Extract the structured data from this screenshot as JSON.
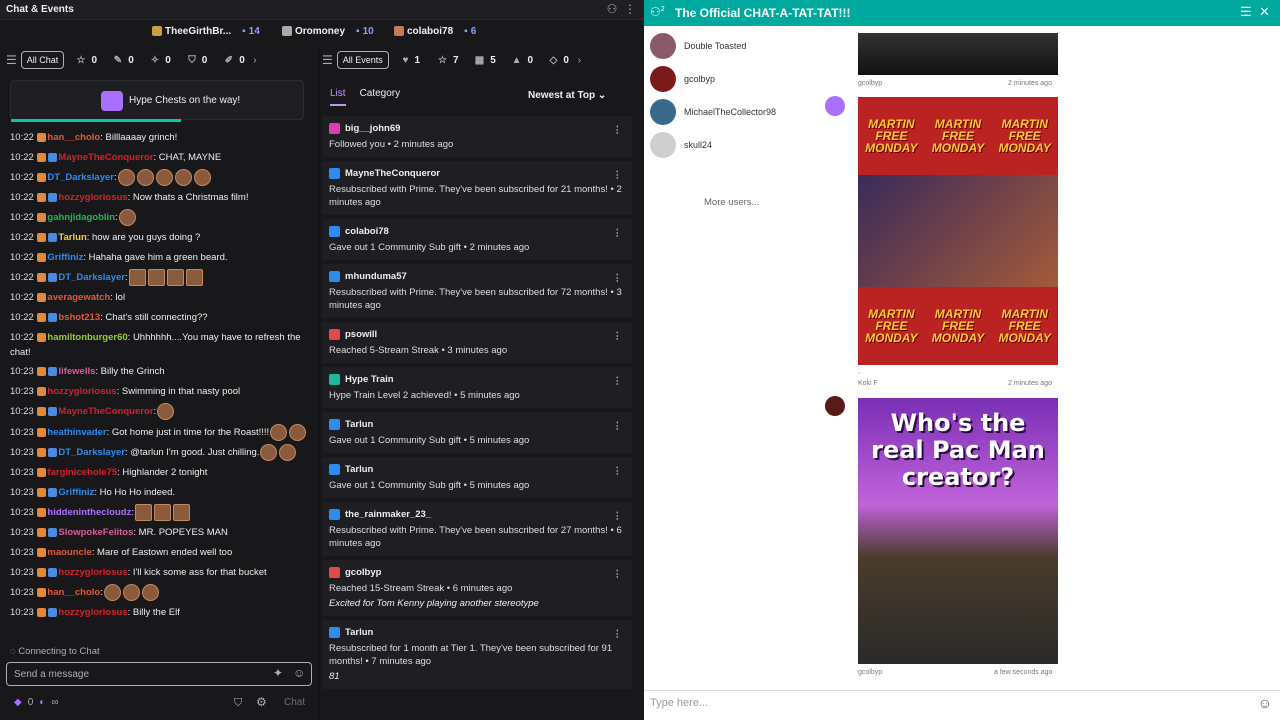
{
  "left": {
    "title": "Chat & Events",
    "top_chatters": [
      {
        "name": "TheeGirthBr...",
        "count": "14",
        "color": "#c9a23f"
      },
      {
        "name": "Oromoney",
        "count": "10",
        "color": "#aaa"
      },
      {
        "name": "colaboi78",
        "count": "6",
        "color": "#c7795a"
      }
    ],
    "chat_bar": {
      "filter": "All Chat",
      "counts": [
        "0",
        "0",
        "0",
        "0",
        "0"
      ]
    },
    "events_bar": {
      "filter": "All Events",
      "counts": [
        "1",
        "7",
        "5",
        "0",
        "0"
      ]
    },
    "hype": "Hype Chests on the way!",
    "messages": [
      {
        "time": "10:22",
        "user": "han__cholo",
        "color": "#e05a3a",
        "text": ": Billlaaaay grinch!",
        "emotes": 0
      },
      {
        "time": "10:22",
        "user": "MayneTheConqueror",
        "color": "#d0232d",
        "text": ": CHAT, MAYNE",
        "emotes": 0
      },
      {
        "time": "10:22",
        "user": "DT_Darkslayer",
        "color": "#2d8cf0",
        "text": ":",
        "emotes": 5
      },
      {
        "time": "10:22",
        "user": "hozzygloriosus",
        "color": "#d0232d",
        "text": ": Now thats a Christmas film!",
        "emotes": 0
      },
      {
        "time": "10:22",
        "user": "gahnjidagoblin",
        "color": "#1fb859",
        "text": ":",
        "emotes": 1
      },
      {
        "time": "10:22",
        "user": "Tarlun",
        "color": "#e8d34a",
        "text": ": how are you guys doing ?",
        "emotes": 0
      },
      {
        "time": "10:22",
        "user": "Griffiniz",
        "color": "#2d8cf0",
        "text": ": Hahaha gave him a green beard.",
        "emotes": 0
      },
      {
        "time": "10:22",
        "user": "DT_Darkslayer",
        "color": "#2d8cf0",
        "text": ":",
        "emotes": 4
      },
      {
        "time": "10:22",
        "user": "averagewatch",
        "color": "#e05a3a",
        "text": ": lol",
        "emotes": 0
      },
      {
        "time": "10:22",
        "user": "bshot213",
        "color": "#e05a3a",
        "text": ": Chat's still connecting??",
        "emotes": 0
      },
      {
        "time": "10:22",
        "user": "hamiltonburger60",
        "color": "#9acd32",
        "text": ": Uhhhhhh....You may have to refresh the chat!",
        "emotes": 0
      },
      {
        "time": "10:23",
        "user": "lifewells",
        "color": "#e05a9a",
        "text": ": Billy the Grinch",
        "emotes": 0
      },
      {
        "time": "10:23",
        "user": "hozzygloriosus",
        "color": "#d0232d",
        "text": ": Swimming in that nasty pool",
        "emotes": 0
      },
      {
        "time": "10:23",
        "user": "MayneTheConqueror",
        "color": "#d0232d",
        "text": ":",
        "emotes": 1
      },
      {
        "time": "10:23",
        "user": "heathinvader",
        "color": "#2d8cf0",
        "text": ": Got home just in time for the Roast!!!!",
        "emotes": 2
      },
      {
        "time": "10:23",
        "user": "DT_Darkslayer",
        "color": "#2d8cf0",
        "text": ": @tarlun I'm good. Just chilling.",
        "emotes": 2
      },
      {
        "time": "10:23",
        "user": "farginicehole75",
        "color": "#d0232d",
        "text": ": Highlander 2 tonight",
        "emotes": 0
      },
      {
        "time": "10:23",
        "user": "Griffiniz",
        "color": "#2d8cf0",
        "text": ": Ho Ho Ho indeed.",
        "emotes": 0
      },
      {
        "time": "10:23",
        "user": "hiddeninthecloudz",
        "color": "#a970ff",
        "text": ":",
        "emotes": 3
      },
      {
        "time": "10:23",
        "user": "SlowpokeFelitos",
        "color": "#e05a9a",
        "text": ": MR. POPEYES MAN",
        "emotes": 0
      },
      {
        "time": "10:23",
        "user": "maouncle",
        "color": "#e05a3a",
        "text": ": Mare of Eastown ended well too",
        "emotes": 0
      },
      {
        "time": "10:23",
        "user": "hozzygloriosus",
        "color": "#d0232d",
        "text": ": I'll kick some ass for that bucket",
        "emotes": 0
      },
      {
        "time": "10:23",
        "user": "han__cholo",
        "color": "#e05a3a",
        "text": ":",
        "emotes": 3
      },
      {
        "time": "10:23",
        "user": "hozzygloriosus",
        "color": "#d0232d",
        "text": ": Billy the Elf",
        "emotes": 0
      }
    ],
    "connecting": "Connecting to Chat",
    "input_placeholder": "Send a message",
    "footer": {
      "bits": "0",
      "points": "∞",
      "chat_button": "Chat"
    },
    "events_tabs": [
      "List",
      "Category"
    ],
    "sort": "Newest at Top",
    "events": [
      {
        "user": "big__john69",
        "color": "#e03ab5",
        "lines": [
          "Followed you • 2 minutes ago"
        ],
        "note": ""
      },
      {
        "user": "MayneTheConqueror",
        "color": "#2d8cf0",
        "lines": [
          "Resubscribed with Prime. They've been subscribed for 21 months! • 2 minutes ago"
        ],
        "note": ""
      },
      {
        "user": "colaboi78",
        "color": "#2d8cf0",
        "lines": [
          "Gave out 1 Community Sub gift • 2 minutes ago"
        ],
        "note": ""
      },
      {
        "user": "mhunduma57",
        "color": "#2d8cf0",
        "lines": [
          "Resubscribed with Prime. They've been subscribed for 72 months! • 3 minutes ago"
        ],
        "note": ""
      },
      {
        "user": "psowill",
        "color": "#e04a4a",
        "lines": [
          "Reached 5-Stream Streak • 3 minutes ago"
        ],
        "note": ""
      },
      {
        "user": "Hype Train",
        "color": "#1fb89a",
        "lines": [
          "Hype Train Level 2 achieved! • 5 minutes ago"
        ],
        "note": ""
      },
      {
        "user": "Tarlun",
        "color": "#2d8cf0",
        "lines": [
          "Gave out 1 Community Sub gift • 5 minutes ago"
        ],
        "note": ""
      },
      {
        "user": "Tarlun",
        "color": "#2d8cf0",
        "lines": [
          "Gave out 1 Community Sub gift • 5 minutes ago"
        ],
        "note": ""
      },
      {
        "user": "the_rainmaker_23_",
        "color": "#2d8cf0",
        "lines": [
          "Resubscribed with Prime. They've been subscribed for 27 months! • 6 minutes ago"
        ],
        "note": ""
      },
      {
        "user": "gcolbyp",
        "color": "#e04a4a",
        "lines": [
          "Reached 15-Stream Streak • 6 minutes ago"
        ],
        "note": "Excited for Tom Kenny playing another stereotype"
      },
      {
        "user": "Tarlun",
        "color": "#2d8cf0",
        "lines": [
          "Resubscribed for 1 month at Tier 1. They've been subscribed for 91 months! • 7 minutes ago"
        ],
        "note": "81"
      }
    ]
  },
  "right": {
    "badge": "2",
    "title": "The Official CHAT-A-TAT-TAT!!!",
    "users": [
      {
        "name": "Double Toasted",
        "color": "#8a5a6a"
      },
      {
        "name": "gcolbyp",
        "color": "#7a1a1a"
      },
      {
        "name": "MichaelTheCollector98",
        "color": "#3a6a8a"
      },
      {
        "name": "skull24",
        "color": "#cfcfcf"
      }
    ],
    "more_users": "More users...",
    "posts": [
      {
        "author": "gcolbyp",
        "time": "2 minutes ago"
      },
      {
        "author": "Koki F",
        "time": "2 minutes ago",
        "caption_mark": ";",
        "banner": "MARTIN FREE MONDAY"
      },
      {
        "author": "gcolbyp",
        "time": "a few seconds ago",
        "headline": "Who's the real Pac Man creator?"
      }
    ],
    "input_placeholder": "Type here..."
  }
}
